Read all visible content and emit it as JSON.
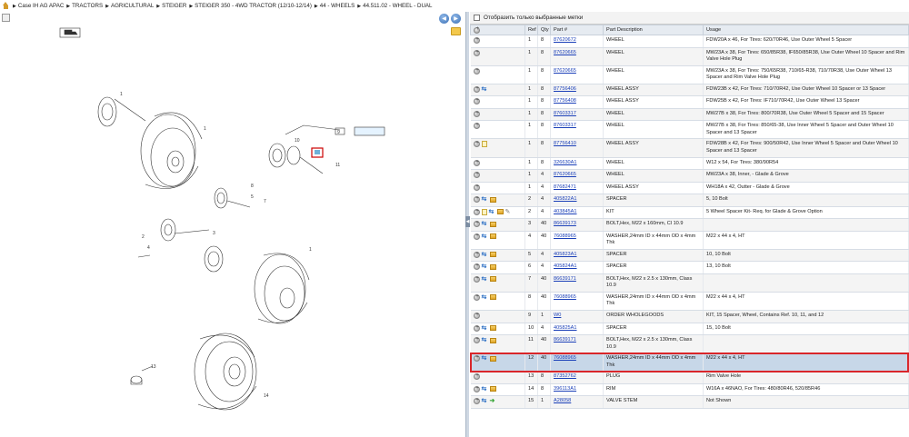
{
  "breadcrumb": {
    "items": [
      "Case IH AG APAC",
      "TRACTORS",
      "AGRICULTURAL",
      "STEIGER",
      "STEIGER 350 - 4WD TRACTOR (12/10-12/14)",
      "44 - WHEELS",
      "44.511.02 - WHEEL - DUAL"
    ]
  },
  "filter": {
    "label": "Отобразить только выбранные метки"
  },
  "table": {
    "columns": [
      "",
      "Ref",
      "Qty",
      "Part #",
      "Part Description",
      "Usage"
    ],
    "rows": [
      {
        "icons": [
          "plus"
        ],
        "ref": "1",
        "qty": "8",
        "part": "87620672",
        "desc": "WHEEL",
        "usage": "FDW20A x 46, For Tires: 620/70R46, Use Outer Wheel 5 Spacer"
      },
      {
        "icons": [
          "plus"
        ],
        "ref": "1",
        "qty": "8",
        "part": "87620665",
        "desc": "WHEEL",
        "usage": "MW23A x 38, For Tires: 650/85R38, IF650/85R38, Use Outer Wheel 10 Spacer and Rim Valve Hole Plug"
      },
      {
        "icons": [
          "plus"
        ],
        "ref": "1",
        "qty": "8",
        "part": "87620665",
        "desc": "WHEEL",
        "usage": "MW23A x 38, For Tires: 750/65R38, 710/65-R38, 710/70R38, Use Outer Wheel 13 Spacer and Rim Valve Hole Plug"
      },
      {
        "icons": [
          "plus",
          "swap"
        ],
        "ref": "1",
        "qty": "8",
        "part": "87756406",
        "desc": "WHEEL ASSY",
        "usage": "FDW23B x 42, For Tires: 710/70R42, Use Outer Wheel 10 Spacer or 13 Spacer"
      },
      {
        "icons": [
          "plus"
        ],
        "ref": "1",
        "qty": "8",
        "part": "87756408",
        "desc": "WHEEL ASSY",
        "usage": "FDW25B x 42, For Tires: IF710/70R42, Use Outer Wheel 13 Spacer"
      },
      {
        "icons": [
          "plus"
        ],
        "ref": "1",
        "qty": "8",
        "part": "87603317",
        "desc": "WHEEL",
        "usage": "MW27B x 38, For Tires: 800/70R38, Use Outer Wheel 5 Spacer and 15 Spacer"
      },
      {
        "icons": [
          "plus"
        ],
        "ref": "1",
        "qty": "8",
        "part": "87603317",
        "desc": "WHEEL",
        "usage": "MW27B x 38, For Tires: 850/65-38, Use Inner Wheel 5 Spacer and Outer Wheel 10 Spacer and 13 Spacer"
      },
      {
        "icons": [
          "plus",
          "note"
        ],
        "ref": "1",
        "qty": "8",
        "part": "87756410",
        "desc": "WHEEL ASSY",
        "usage": "FDW28B x 42, For Tires: 900/50R42, Use Inner Wheel 5 Spacer and Outer Wheel 10 Spacer and 13 Spacer"
      },
      {
        "icons": [
          "plus"
        ],
        "ref": "1",
        "qty": "8",
        "part": "326630A1",
        "desc": "WHEEL",
        "usage": "W12 x 54, For Tires: 380/90R54"
      },
      {
        "icons": [
          "plus"
        ],
        "ref": "1",
        "qty": "4",
        "part": "87620665",
        "desc": "WHEEL",
        "usage": "MW23A x 38, Inner, - Glade & Grove"
      },
      {
        "icons": [
          "plus"
        ],
        "ref": "1",
        "qty": "4",
        "part": "87682471",
        "desc": "WHEEL ASSY",
        "usage": "WH18A x 42, Outter - Glade & Grove"
      },
      {
        "icons": [
          "plus",
          "swap",
          "box"
        ],
        "ref": "2",
        "qty": "4",
        "part": "405822A1",
        "desc": "SPACER",
        "usage": "5, 10 Bolt"
      },
      {
        "icons": [
          "plus",
          "note",
          "swap",
          "box",
          "pencil"
        ],
        "ref": "2",
        "qty": "4",
        "part": "403845A1",
        "desc": "KIT",
        "usage": "5 Wheel Spacer Kit- Req. for Glade & Grove Option"
      },
      {
        "icons": [
          "plus",
          "swap",
          "box"
        ],
        "ref": "3",
        "qty": "40",
        "part": "86639173",
        "desc": "BOLT,Hex, M22 x 160mm, Cl 10.9",
        "usage": ""
      },
      {
        "icons": [
          "plus",
          "swap",
          "box"
        ],
        "ref": "4",
        "qty": "40",
        "part": "76088965",
        "desc": "WASHER,24mm ID x 44mm OD x 4mm Thk",
        "usage": "M22 x 44 x 4, HT"
      },
      {
        "icons": [
          "plus",
          "swap",
          "box"
        ],
        "ref": "5",
        "qty": "4",
        "part": "405823A1",
        "desc": "SPACER",
        "usage": "10, 10 Bolt"
      },
      {
        "icons": [
          "plus",
          "swap",
          "box"
        ],
        "ref": "6",
        "qty": "4",
        "part": "405824A1",
        "desc": "SPACER",
        "usage": "13, 10 Bolt"
      },
      {
        "icons": [
          "plus",
          "swap",
          "box"
        ],
        "ref": "7",
        "qty": "40",
        "part": "86639171",
        "desc": "BOLT,Hex, M22 x 2.5 x 130mm, Class 10.9",
        "usage": ""
      },
      {
        "icons": [
          "plus",
          "swap",
          "box"
        ],
        "ref": "8",
        "qty": "40",
        "part": "76088965",
        "desc": "WASHER,24mm ID x 44mm OD x 4mm Thk",
        "usage": "M22 x 44 x 4, HT"
      },
      {
        "icons": [
          "plus"
        ],
        "ref": "9",
        "qty": "1",
        "part": "W0",
        "desc": "ORDER WHOLEGOODS",
        "usage": "KIT, 15 Spacer, Wheel, Contains Ref. 10, 11, and 12"
      },
      {
        "icons": [
          "plus",
          "swap",
          "box"
        ],
        "ref": "10",
        "qty": "4",
        "part": "405825A1",
        "desc": "SPACER",
        "usage": "15, 10 Bolt"
      },
      {
        "icons": [
          "plus",
          "swap",
          "box"
        ],
        "ref": "11",
        "qty": "40",
        "part": "86639171",
        "desc": "BOLT,Hex, M22 x 2.5 x 130mm, Class 10.9",
        "usage": ""
      },
      {
        "icons": [
          "plus",
          "swap",
          "box"
        ],
        "ref": "12",
        "qty": "40",
        "part": "76088965",
        "desc": "WASHER,24mm ID x 44mm OD x 4mm Thk",
        "usage": "M22 x 44 x 4, HT",
        "selected": true
      },
      {
        "icons": [
          "plus"
        ],
        "ref": "13",
        "qty": "8",
        "part": "87352762",
        "desc": "PLUG",
        "usage": "Rim Valve Hole"
      },
      {
        "icons": [
          "plus",
          "swap",
          "box"
        ],
        "ref": "14",
        "qty": "8",
        "part": "396113A1",
        "desc": "RIM",
        "usage": "W16A x 46NAO, For Tires: 480/80R46, 520/85R46"
      },
      {
        "icons": [
          "plus",
          "swap",
          "arrow"
        ],
        "ref": "15",
        "qty": "1",
        "part": "A28058",
        "desc": "VALVE STEM",
        "usage": "Not Shown"
      }
    ]
  },
  "diagram": {
    "callouts": [
      "1",
      "2",
      "3",
      "4",
      "5",
      "6",
      "7",
      "8",
      "9",
      "10",
      "11",
      "12",
      "13",
      "14",
      "1",
      "2",
      "3",
      "4",
      "1"
    ]
  }
}
